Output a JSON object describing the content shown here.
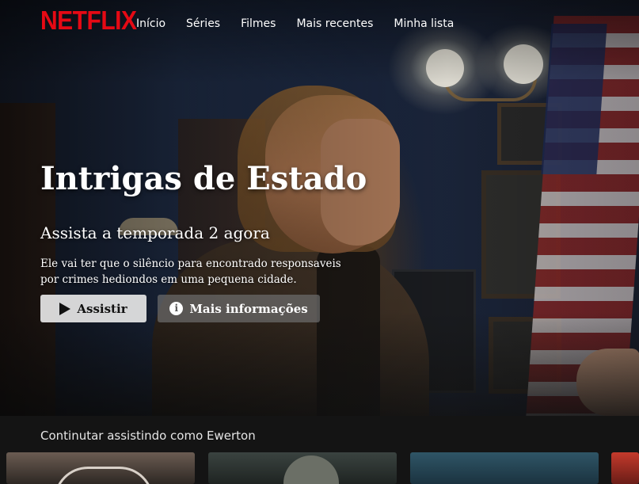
{
  "brand": {
    "logo_text": "NETFLIX",
    "color": "#e50914"
  },
  "nav": {
    "items": [
      {
        "label": "Início"
      },
      {
        "label": "Séries"
      },
      {
        "label": "Filmes"
      },
      {
        "label": "Mais recentes"
      },
      {
        "label": "Minha lista"
      }
    ]
  },
  "hero": {
    "title": "Intrigas de Estado",
    "subtitle": "Assista a temporada 2 agora",
    "description": "Ele vai ter que o silêncio para encontrado responsaveis por crimes hediondos em uma pequena cidade.",
    "play_button": {
      "label": "Assistir",
      "icon": "play-icon"
    },
    "info_button": {
      "label": "Mais informações",
      "icon": "info-icon",
      "icon_glyph": "i"
    }
  },
  "row": {
    "title": "Continutar assistindo como Ewerton",
    "items": [
      {
        "name": "thumbnail-1"
      },
      {
        "name": "thumbnail-2"
      },
      {
        "name": "thumbnail-3"
      },
      {
        "name": "thumbnail-4"
      }
    ]
  },
  "colors": {
    "background": "#141414",
    "text": "#ffffff",
    "play_button_bg": "#e6e6e6",
    "info_button_bg": "#6d6d6e"
  }
}
